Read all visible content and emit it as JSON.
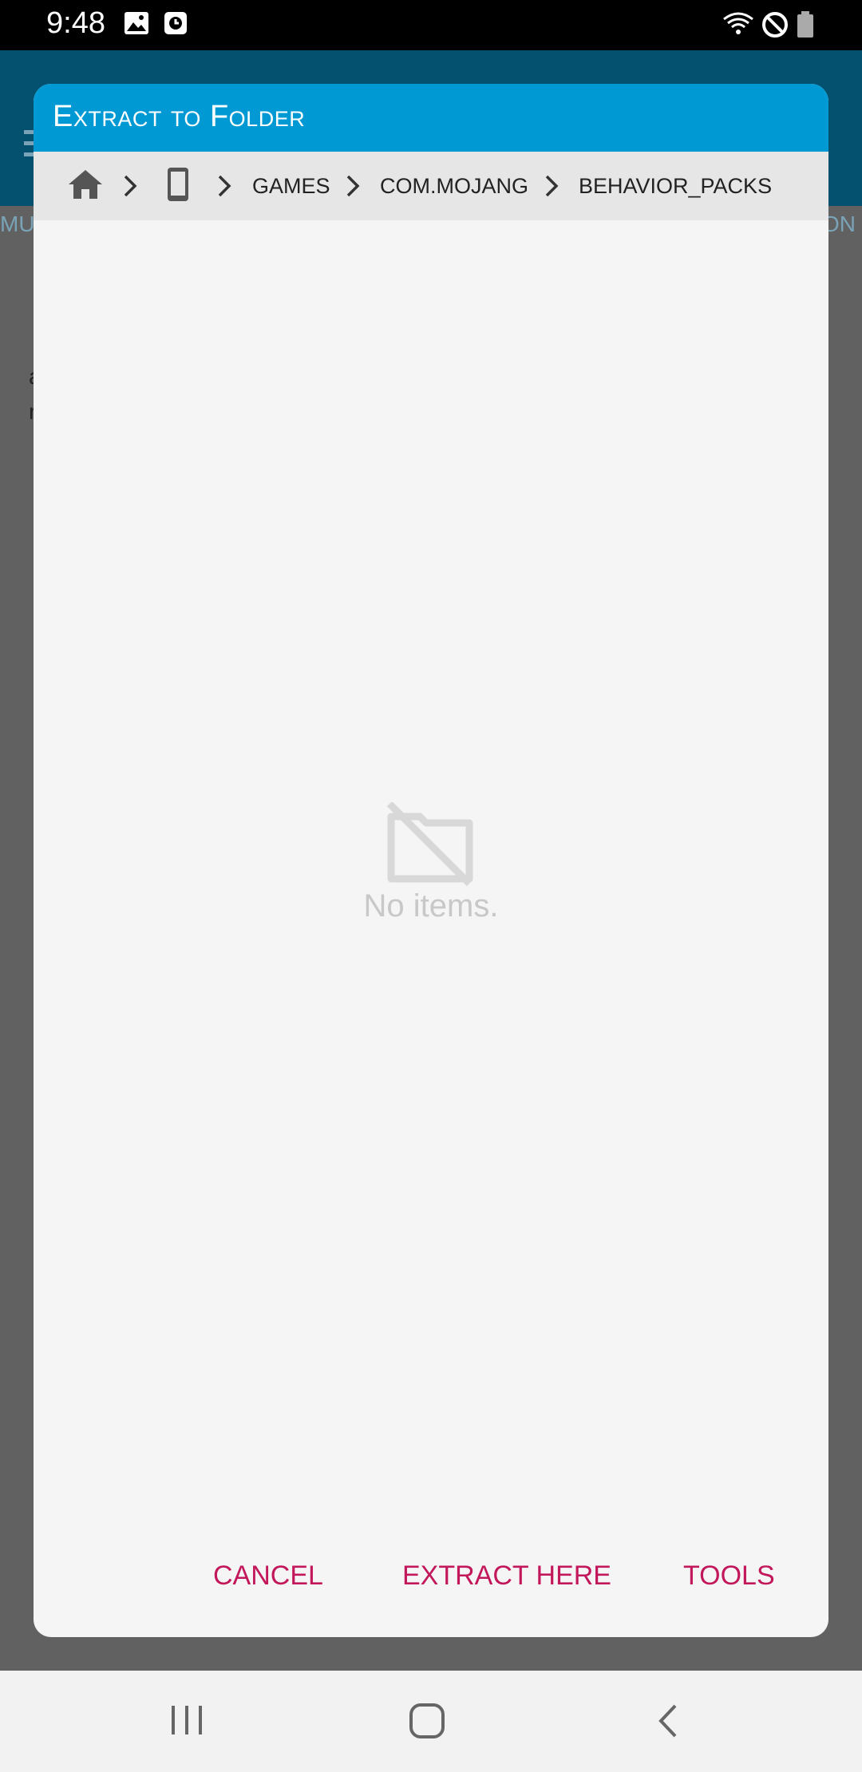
{
  "status": {
    "time": "9:48"
  },
  "background": {
    "tab_left": "MU",
    "tab_right": "ON",
    "text_line1": "a",
    "text_line2": "r"
  },
  "dialog": {
    "title": "Extract to Folder",
    "breadcrumb": [
      "GAMES",
      "COM.MOJANG",
      "BEHAVIOR_PACKS"
    ],
    "empty_text": "No items.",
    "buttons": {
      "cancel": "CANCEL",
      "extract": "EXTRACT HERE",
      "tools": "TOOLS"
    }
  },
  "colors": {
    "header": "#0099d3",
    "accent": "#c2185b",
    "statusbar": "#000000"
  }
}
